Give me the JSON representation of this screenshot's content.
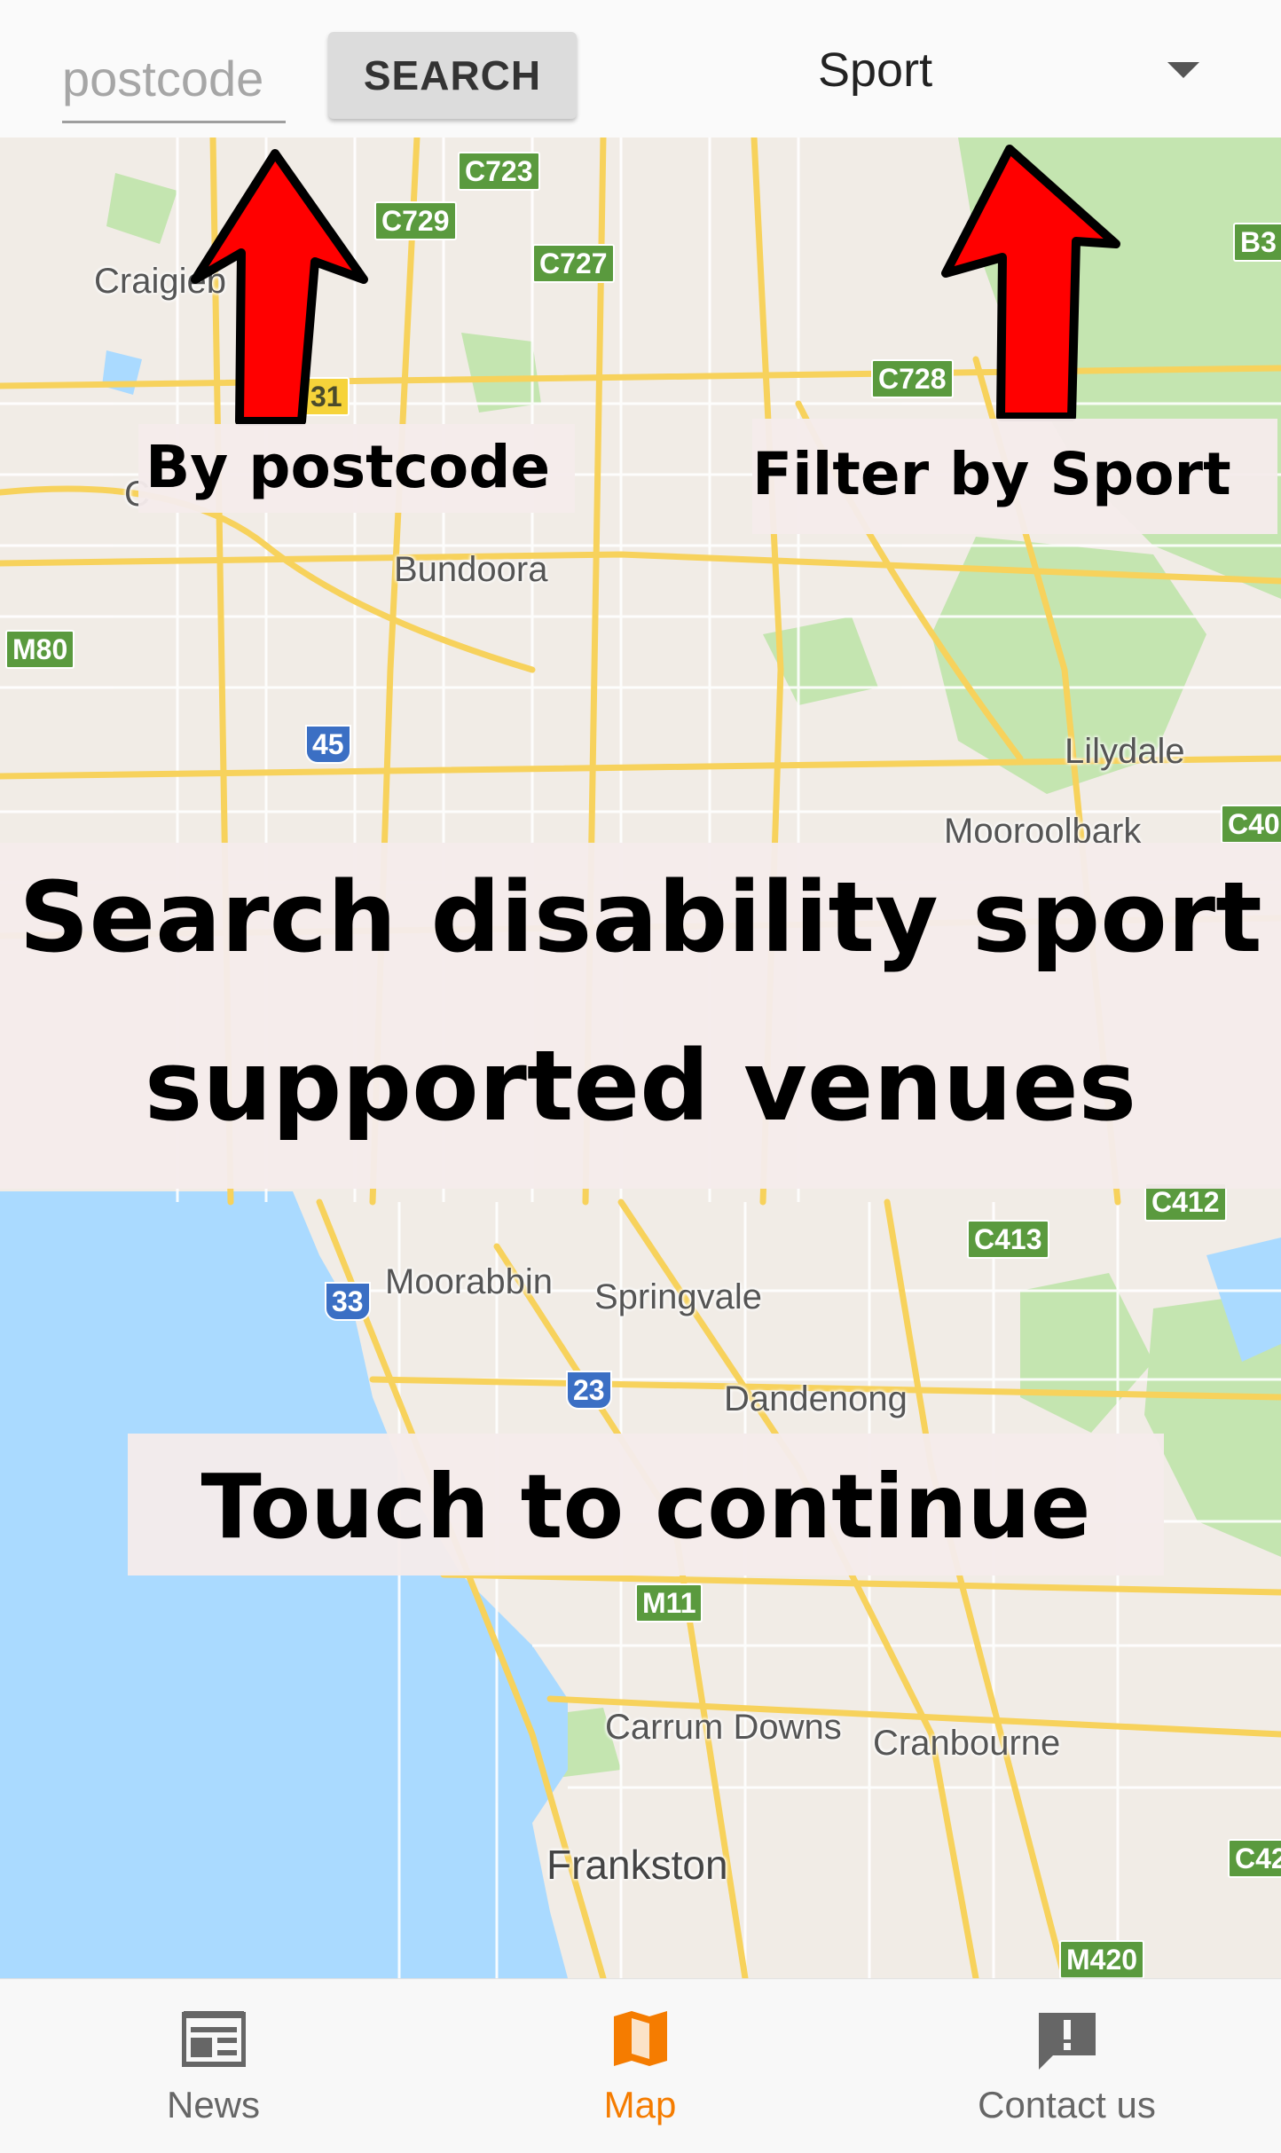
{
  "search": {
    "placeholder": "postcode",
    "button_label": "SEARCH"
  },
  "sport_filter": {
    "selected": "Sport"
  },
  "map": {
    "places": [
      "Craigieb",
      "C",
      "Bundoora",
      "Lilydale",
      "Mooroolbark",
      "Moorabbin",
      "Springvale",
      "Dandenong",
      "Carrum Downs",
      "Cranbourne",
      "Frankston"
    ],
    "route_shields": [
      "C723",
      "C729",
      "C727",
      "B3",
      "31",
      "C728",
      "M80",
      "45",
      "C40",
      "C412",
      "C413",
      "33",
      "23",
      "M11",
      "C42",
      "M420"
    ]
  },
  "overlays": {
    "postcode_callout": "By postcode",
    "sport_callout": "Filter by Sport",
    "headline_line1": "Search disability sport",
    "headline_line2": "supported venues",
    "continue": "Touch to continue"
  },
  "bottom_nav": {
    "items": [
      {
        "label": "News",
        "icon": "news-icon"
      },
      {
        "label": "Map",
        "icon": "map-icon",
        "active": true
      },
      {
        "label": "Contact us",
        "icon": "feedback-icon"
      }
    ]
  },
  "colors": {
    "accent": "#f57c00",
    "arrow": "#ff0000",
    "water": "#aadaff",
    "road": "#f7d25c",
    "park": "#c4e5b0"
  }
}
